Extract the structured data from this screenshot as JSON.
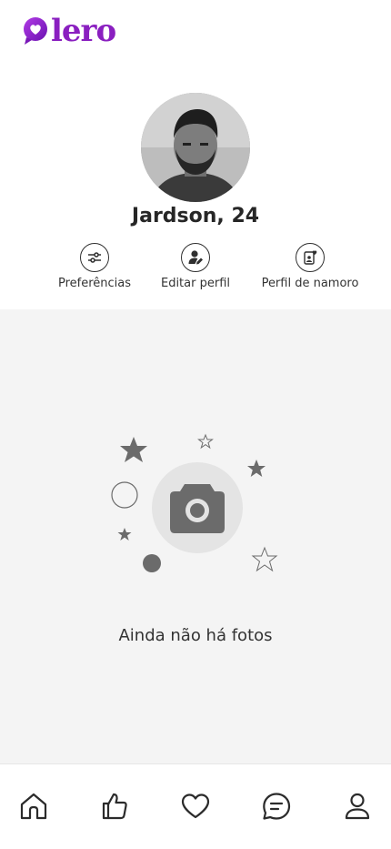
{
  "app": {
    "logo_text": "lero",
    "brand_color": "#8a1fc0"
  },
  "profile": {
    "name_age": "Jardson, 24"
  },
  "actions": [
    {
      "label": "Preferências",
      "icon": "sliders-icon"
    },
    {
      "label": "Editar perfil",
      "icon": "edit-user-icon"
    },
    {
      "label": "Perfil de namoro",
      "icon": "dating-profile-icon"
    }
  ],
  "photos": {
    "empty_message": "Ainda não há fotos",
    "illustration_icon": "camera-icon"
  },
  "bottom_nav": [
    {
      "name": "home",
      "icon": "home-icon"
    },
    {
      "name": "likes",
      "icon": "thumbs-up-icon"
    },
    {
      "name": "matches",
      "icon": "heart-icon"
    },
    {
      "name": "chat",
      "icon": "chat-icon"
    },
    {
      "name": "profile",
      "icon": "user-icon"
    }
  ],
  "colors": {
    "content_background": "#f4f4f4",
    "illustration_gray": "#6b6b6b"
  }
}
